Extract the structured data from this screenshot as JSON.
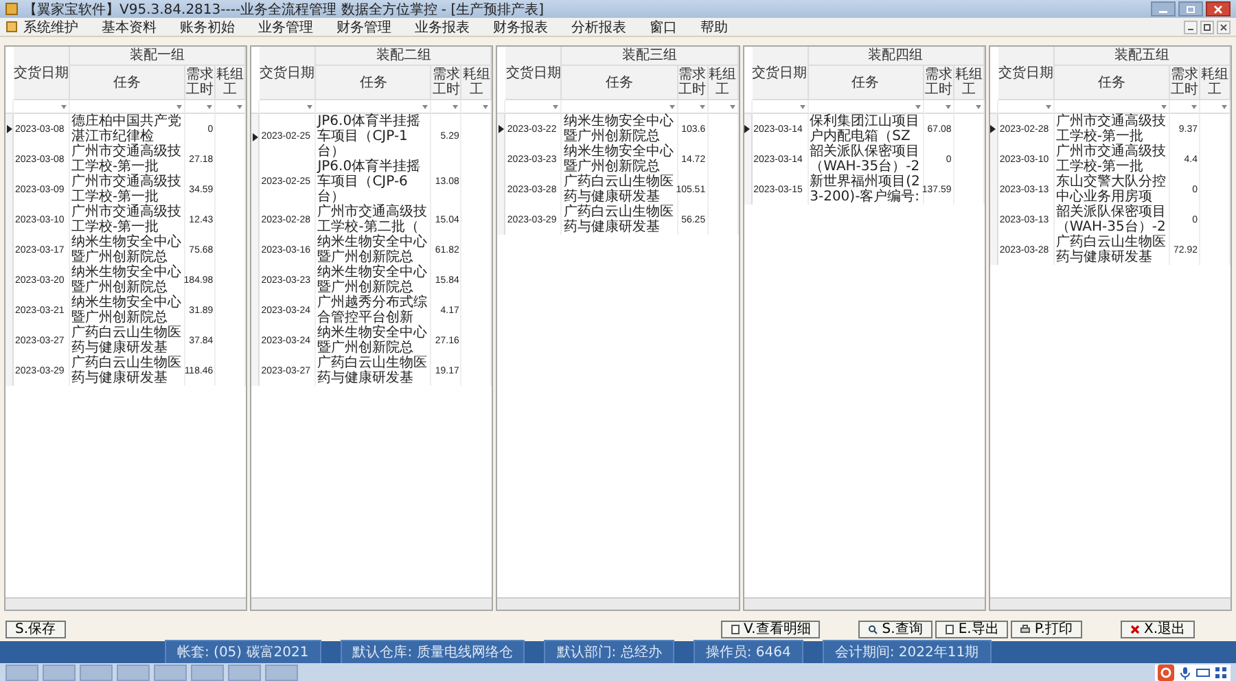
{
  "window": {
    "title": "【翼家宝软件】V95.3.84.2813----业务全流程管理 数据全方位掌控 - [生产预排产表]"
  },
  "menu": [
    "系统维护",
    "基本资料",
    "账务初始",
    "业务管理",
    "财务管理",
    "业务报表",
    "财务报表",
    "分析报表",
    "窗口",
    "帮助"
  ],
  "panels": [
    {
      "group": "装配一组",
      "columns": [
        "交货日期",
        "任务",
        "需求工时",
        "耗组工"
      ],
      "rows": [
        {
          "date": "2023-03-08",
          "task": "德庄柏中国共产党湛江市纪律检",
          "hours": "0",
          "selected": true
        },
        {
          "date": "2023-03-08",
          "task": "广州市交通高级技工学校-第一批",
          "hours": "27.18",
          "selected": false
        },
        {
          "date": "2023-03-09",
          "task": "广州市交通高级技工学校-第一批",
          "hours": "34.59",
          "selected": false
        },
        {
          "date": "2023-03-10",
          "task": "广州市交通高级技工学校-第一批",
          "hours": "12.43",
          "selected": false
        },
        {
          "date": "2023-03-17",
          "task": "纳米生物安全中心暨广州创新院总",
          "hours": "75.68",
          "selected": false
        },
        {
          "date": "2023-03-20",
          "task": "纳米生物安全中心暨广州创新院总",
          "hours": "184.98",
          "selected": false
        },
        {
          "date": "2023-03-21",
          "task": "纳米生物安全中心暨广州创新院总",
          "hours": "31.89",
          "selected": false
        },
        {
          "date": "2023-03-27",
          "task": "广药白云山生物医药与健康研发基",
          "hours": "37.84",
          "selected": false
        },
        {
          "date": "2023-03-29",
          "task": "广药白云山生物医药与健康研发基",
          "hours": "118.46",
          "selected": false
        }
      ]
    },
    {
      "group": "装配二组",
      "columns": [
        "交货日期",
        "任务",
        "需求工时",
        "耗组工"
      ],
      "rows": [
        {
          "date": "2023-02-25",
          "task": "JP6.0体育半挂摇车项目（CJP-1台）",
          "hours": "5.29",
          "selected": true
        },
        {
          "date": "2023-02-25",
          "task": "JP6.0体育半挂摇车项目（CJP-6台）",
          "hours": "13.08",
          "selected": false
        },
        {
          "date": "2023-02-28",
          "task": "广州市交通高级技工学校-第二批（",
          "hours": "15.04",
          "selected": false
        },
        {
          "date": "2023-03-16",
          "task": "纳米生物安全中心暨广州创新院总",
          "hours": "61.82",
          "selected": false
        },
        {
          "date": "2023-03-23",
          "task": "纳米生物安全中心暨广州创新院总",
          "hours": "15.84",
          "selected": false
        },
        {
          "date": "2023-03-24",
          "task": "广州越秀分布式综合管控平台创新",
          "hours": "4.17",
          "selected": false
        },
        {
          "date": "2023-03-24",
          "task": "纳米生物安全中心暨广州创新院总",
          "hours": "27.16",
          "selected": false
        },
        {
          "date": "2023-03-27",
          "task": "广药白云山生物医药与健康研发基",
          "hours": "19.17",
          "selected": false
        }
      ]
    },
    {
      "group": "装配三组",
      "columns": [
        "交货日期",
        "任务",
        "需求工时",
        "耗组工"
      ],
      "rows": [
        {
          "date": "2023-03-22",
          "task": "纳米生物安全中心暨广州创新院总",
          "hours": "103.6",
          "selected": true
        },
        {
          "date": "2023-03-23",
          "task": "纳米生物安全中心暨广州创新院总",
          "hours": "14.72",
          "selected": false
        },
        {
          "date": "2023-03-28",
          "task": "广药白云山生物医药与健康研发基",
          "hours": "105.51",
          "selected": false
        },
        {
          "date": "2023-03-29",
          "task": "广药白云山生物医药与健康研发基",
          "hours": "56.25",
          "selected": false
        }
      ]
    },
    {
      "group": "装配四组",
      "columns": [
        "交货日期",
        "任务",
        "需求工时",
        "耗组工"
      ],
      "rows": [
        {
          "date": "2023-03-14",
          "task": "保利集团江山项目户内配电箱（SZ",
          "hours": "67.08",
          "selected": true
        },
        {
          "date": "2023-03-14",
          "task": "韶关派队保密项目（WAH-35台）-2",
          "hours": "0",
          "selected": false
        },
        {
          "date": "2023-03-15",
          "task": "新世界福州项目(23-200)-客户编号:",
          "hours": "137.59",
          "selected": false
        }
      ]
    },
    {
      "group": "装配五组",
      "columns": [
        "交货日期",
        "任务",
        "需求工时",
        "耗组工"
      ],
      "rows": [
        {
          "date": "2023-02-28",
          "task": "广州市交通高级技工学校-第一批",
          "hours": "9.37",
          "selected": true
        },
        {
          "date": "2023-03-10",
          "task": "广州市交通高级技工学校-第一批",
          "hours": "4.4",
          "selected": false
        },
        {
          "date": "2023-03-13",
          "task": "东山交警大队分控中心业务用房项",
          "hours": "0",
          "selected": false
        },
        {
          "date": "2023-03-13",
          "task": "韶关派队保密项目（WAH-35台）-2",
          "hours": "0",
          "selected": false
        },
        {
          "date": "2023-03-28",
          "task": "广药白云山生物医药与健康研发基",
          "hours": "72.92",
          "selected": false
        }
      ]
    }
  ],
  "buttons_left": [
    {
      "label": "S.保存"
    }
  ],
  "buttons_right": [
    {
      "label": "V.查看明细",
      "kind": "detail"
    },
    {
      "label": "S.查询",
      "kind": "query"
    },
    {
      "label": "E.导出",
      "kind": "export"
    },
    {
      "label": "P.打印",
      "kind": "print"
    },
    {
      "label": "X.退出",
      "kind": "exit"
    }
  ],
  "status_bar": [
    "帐套: (05) 碳富2021",
    "默认仓库: 质量电线网络仓",
    "默认部门: 总经办",
    "操作员: 6464",
    "会计期间: 2022年11期"
  ]
}
